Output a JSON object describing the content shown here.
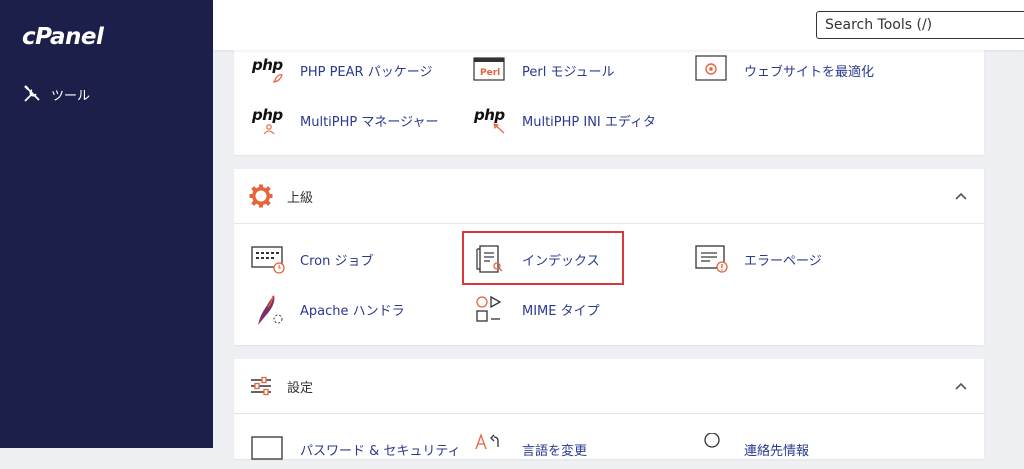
{
  "sidebar": {
    "logo": "cPanel",
    "items": [
      {
        "label": "ツール",
        "icon": "tools-icon"
      }
    ]
  },
  "header": {
    "search_placeholder": "Search Tools (/)"
  },
  "software": {
    "tools": [
      {
        "label": "PHP PEAR パッケージ",
        "icon": "php-pear-icon"
      },
      {
        "label": "Perl モジュール",
        "icon": "perl-icon"
      },
      {
        "label": "ウェブサイトを最適化",
        "icon": "optimize-icon"
      },
      {
        "label": "MultiPHP マネージャー",
        "icon": "php-manager-icon"
      },
      {
        "label": "MultiPHP INI エディタ",
        "icon": "php-ini-icon"
      }
    ]
  },
  "advanced": {
    "title": "上級",
    "tools": [
      {
        "label": "Cron ジョブ",
        "icon": "cron-icon"
      },
      {
        "label": "インデックス",
        "icon": "indexes-icon"
      },
      {
        "label": "エラーページ",
        "icon": "error-page-icon"
      },
      {
        "label": "Apache ハンドラ",
        "icon": "apache-icon"
      },
      {
        "label": "MIME タイプ",
        "icon": "mime-icon"
      }
    ]
  },
  "preferences": {
    "title": "設定",
    "tools": [
      {
        "label": "パスワード & セキュリティ",
        "icon": "password-icon"
      },
      {
        "label": "言語を変更",
        "icon": "language-icon"
      },
      {
        "label": "連絡先情報",
        "icon": "contact-icon"
      }
    ]
  },
  "colors": {
    "sidebar": "#1c1f49",
    "link": "#2b3a8f",
    "accent": "#e8623a",
    "highlight": "#d9363e"
  }
}
